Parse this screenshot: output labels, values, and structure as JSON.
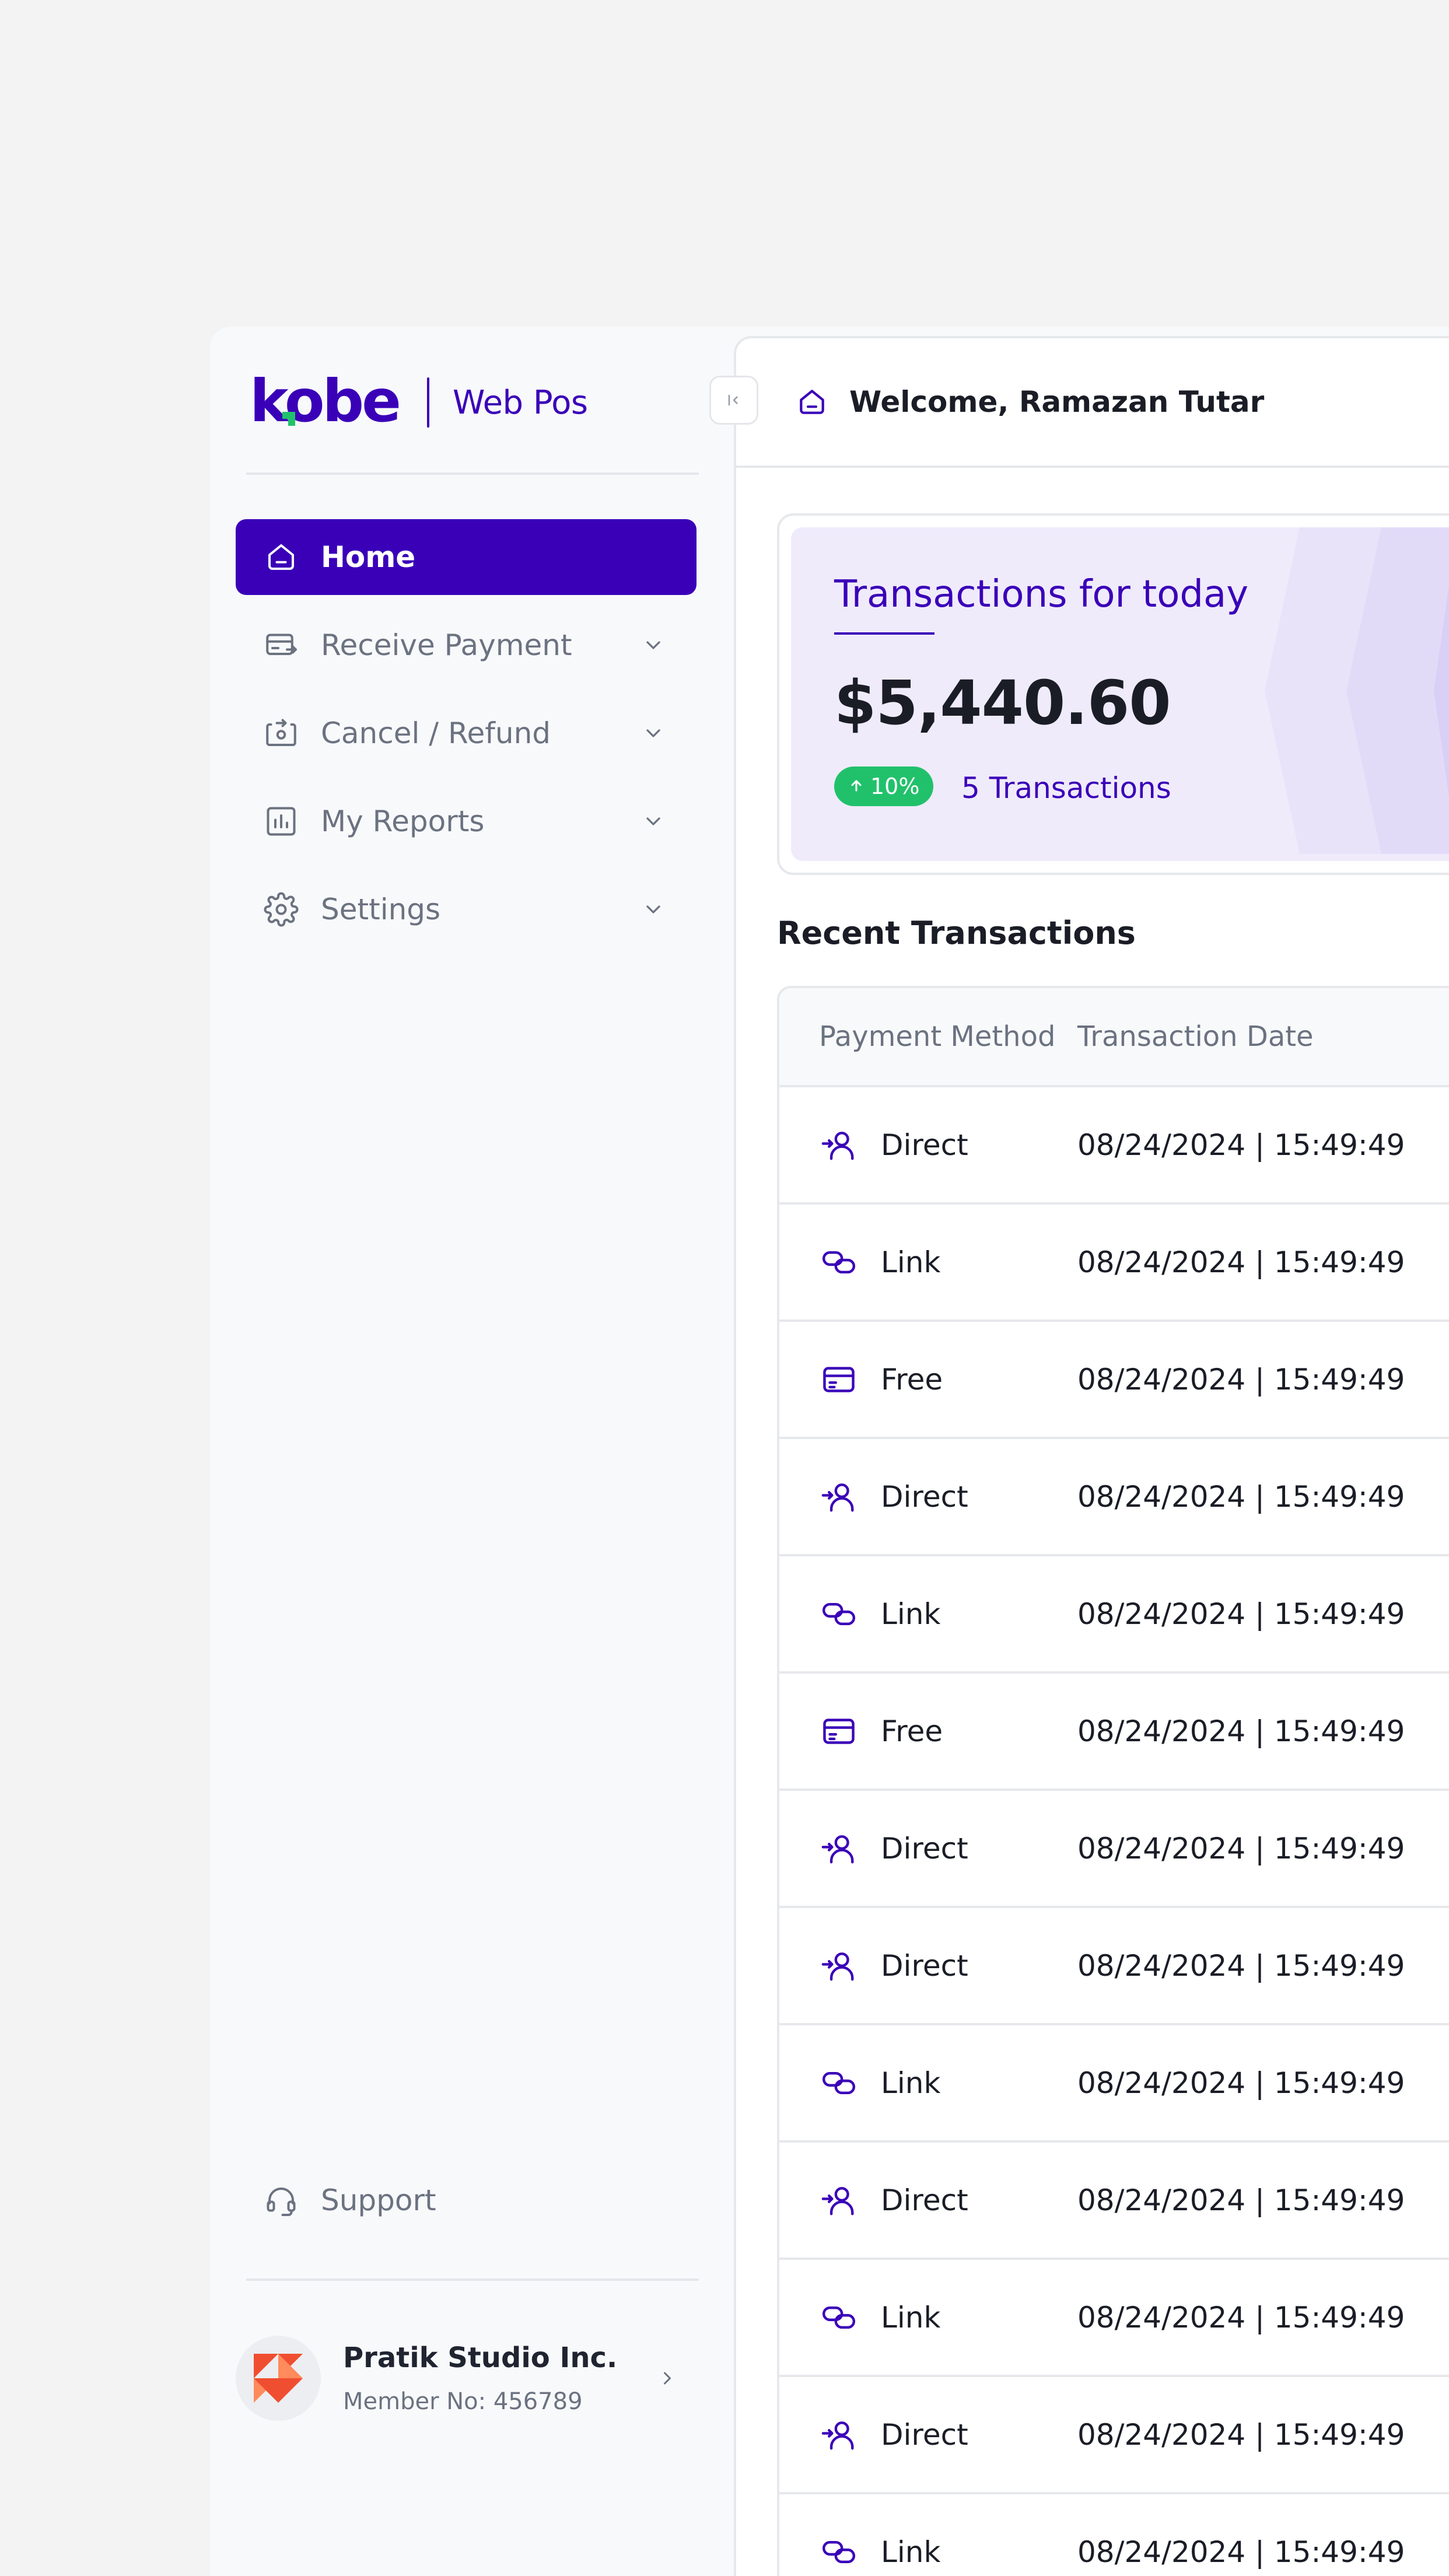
{
  "brand": {
    "logo_text": "kobe",
    "subtitle": "Web Pos",
    "accent_color": "#3a00b8",
    "logo_dot_color": "#21c16b"
  },
  "sidebar": {
    "items": [
      {
        "label": "Home",
        "icon": "home-icon",
        "active": true
      },
      {
        "label": "Receive Payment",
        "icon": "receive-payment-icon",
        "expandable": true
      },
      {
        "label": "Cancel / Refund",
        "icon": "refund-icon",
        "expandable": true
      },
      {
        "label": "My Reports",
        "icon": "reports-icon",
        "expandable": true
      },
      {
        "label": "Settings",
        "icon": "gear-icon",
        "expandable": true
      }
    ],
    "support_label": "Support",
    "profile": {
      "company": "Pratik Studio Inc.",
      "member_no": "Member No: 456789"
    }
  },
  "header": {
    "welcome": "Welcome, Ramazan Tutar"
  },
  "summary": {
    "title": "Transactions for today",
    "amount": "$5,440.60",
    "change_pct": "10%",
    "change_direction": "up",
    "transactions_label": "5 Transactions",
    "badge_color": "#21c16b"
  },
  "recent": {
    "title": "Recent Transactions",
    "columns": [
      "Payment Method",
      "Transaction Date"
    ],
    "rows": [
      {
        "method": "Direct",
        "icon": "user-arrow-icon",
        "date": "08/24/2024 | 15:49:49"
      },
      {
        "method": "Link",
        "icon": "link-icon",
        "date": "08/24/2024 | 15:49:49"
      },
      {
        "method": "Free",
        "icon": "card-icon",
        "date": "08/24/2024 | 15:49:49"
      },
      {
        "method": "Direct",
        "icon": "user-arrow-icon",
        "date": "08/24/2024 | 15:49:49"
      },
      {
        "method": "Link",
        "icon": "link-icon",
        "date": "08/24/2024 | 15:49:49"
      },
      {
        "method": "Free",
        "icon": "card-icon",
        "date": "08/24/2024 | 15:49:49"
      },
      {
        "method": "Direct",
        "icon": "user-arrow-icon",
        "date": "08/24/2024 | 15:49:49"
      },
      {
        "method": "Direct",
        "icon": "user-arrow-icon",
        "date": "08/24/2024 | 15:49:49"
      },
      {
        "method": "Link",
        "icon": "link-icon",
        "date": "08/24/2024 | 15:49:49"
      },
      {
        "method": "Direct",
        "icon": "user-arrow-icon",
        "date": "08/24/2024 | 15:49:49"
      },
      {
        "method": "Link",
        "icon": "link-icon",
        "date": "08/24/2024 | 15:49:49"
      },
      {
        "method": "Direct",
        "icon": "user-arrow-icon",
        "date": "08/24/2024 | 15:49:49"
      },
      {
        "method": "Link",
        "icon": "link-icon",
        "date": "08/24/2024 | 15:49:49"
      }
    ]
  }
}
